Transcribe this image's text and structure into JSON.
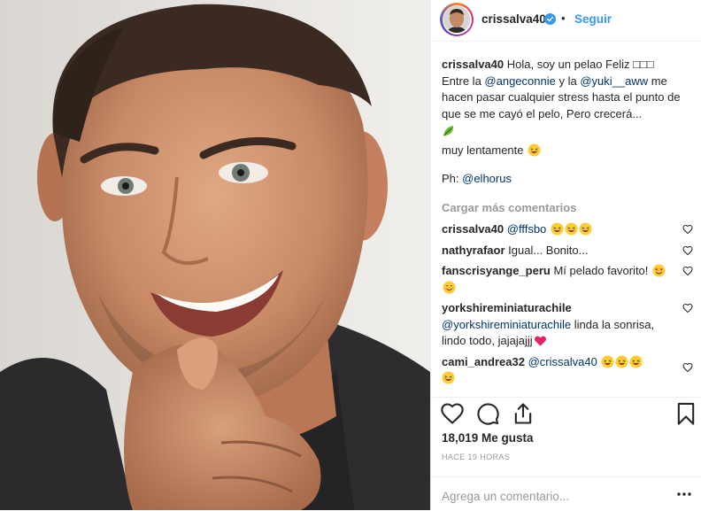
{
  "photo": {
    "alt": "portrait photo"
  },
  "header": {
    "username": "crissalva40",
    "separator": "•",
    "follow_label": "Seguir",
    "verified_icon": "verified-badge-icon"
  },
  "caption": {
    "username": "crissalva40",
    "t1": " Hola, soy un pelao Feliz ",
    "t1_symbols": "□□□",
    "t2": "Entre la ",
    "m1": "@angeconnie",
    "t3": " y la ",
    "m2": "@yuki__aww",
    "t4": " me hacen pasar cualquier stress hasta el punto de que se me cayó el pelo, Pero crecerá...",
    "t5": "muy lentamente ",
    "ph_label": "Ph: ",
    "ph_mention": "@elhorus"
  },
  "load_more": "Cargar más comentarios",
  "comments": [
    {
      "user": "crissalva40",
      "pre": "",
      "mention": "@fffsbo",
      "text": " "
    },
    {
      "user": "nathyrafaor",
      "pre": "",
      "mention": "",
      "text": " Igual... Bonito..."
    },
    {
      "user": "fanscrisyange_peru",
      "pre": "",
      "mention": "",
      "text": " Mí pelado favorito! "
    },
    {
      "user": "yorkshireminiaturachile",
      "pre": "",
      "mention": "@yorkshireminiaturachile",
      "text": " linda la sonrisa, lindo todo, jajajajjj"
    },
    {
      "user": "cami_andrea32",
      "pre": "",
      "mention": "@crissalva40",
      "text": " "
    }
  ],
  "actions": {
    "like_icon": "heart-icon",
    "comment_icon": "comment-icon",
    "share_icon": "share-icon",
    "save_icon": "bookmark-icon"
  },
  "likes": "18,019 Me gusta",
  "time": "HACE 19 HORAS",
  "add_comment": {
    "placeholder": "Agrega un comentario...",
    "more_icon": "more-options-icon"
  },
  "colors": {
    "link": "#3897f0",
    "mention": "#003569",
    "muted": "#999999",
    "text": "#262626"
  }
}
